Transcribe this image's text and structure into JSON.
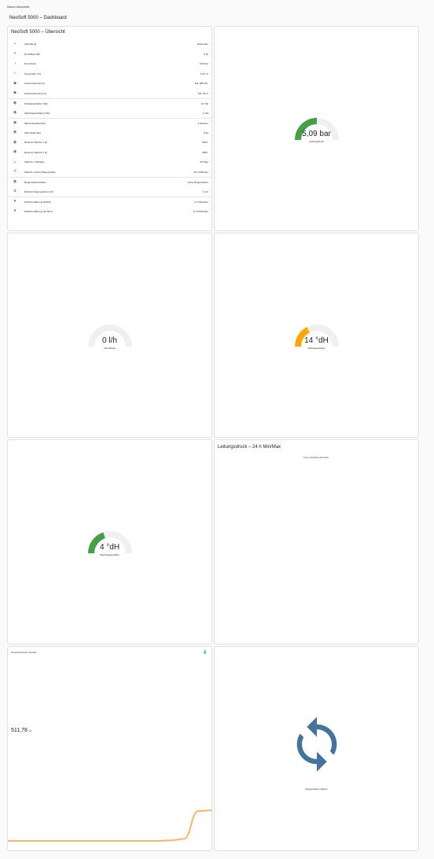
{
  "page": {
    "section_label": "Neuer Abschnitt",
    "dashboard_title": "NeoSoft 5000 – Dashboard"
  },
  "overview": {
    "title": "NeoSoft 5000 – Übersicht",
    "rows": [
      {
        "icon": "plug-icon",
        "label": "Verbindung",
        "value": "Verbunden",
        "divider": false
      },
      {
        "icon": "flow-icon",
        "label": "Durchfluss [l/h]",
        "value": "0 l/h",
        "divider": false
      },
      {
        "icon": "gauge-icon",
        "label": "Druck [bar]",
        "value": "5,09 bar",
        "divider": false
      },
      {
        "icon": "thermometer-icon",
        "label": "Temperatur [°C]",
        "value": "14,9 °C",
        "divider": false
      },
      {
        "icon": "water-icon",
        "label": "Gesamtvolumen [L]",
        "value": "511.785,00 L",
        "divider": false
      },
      {
        "icon": "water-icon",
        "label": "Gesamtvolumen [m³]",
        "value": "511,78 m³",
        "divider": false
      },
      {
        "icon": "eye-icon",
        "label": "Rohwasserhärte [°dH]",
        "value": "14 °dH",
        "divider": true
      },
      {
        "icon": "eye-icon",
        "label": "Weichwasserhärte [°dH]",
        "value": "4 °dH",
        "divider": false
      },
      {
        "icon": "eye-icon",
        "label": "Salzvorrat [Wochen]",
        "value": "4 Wochen",
        "divider": true
      },
      {
        "icon": "eye-icon",
        "label": "Salzmenge [kg]",
        "value": "8 kg",
        "divider": false
      },
      {
        "icon": "eye-icon",
        "label": "Reserve Flasche 1 [L]",
        "value": "869 L",
        "divider": false
      },
      {
        "icon": "eye-icon",
        "label": "Reserve Flasche 2 [L]",
        "value": "868 L",
        "divider": false
      },
      {
        "icon": "user-icon",
        "label": "Flasche 1 Salztage",
        "value": "49 Tage",
        "divider": false
      },
      {
        "icon": "history-icon",
        "label": "Flasche 1 letzte Regeneration",
        "value": "Vor 8 Minuten",
        "divider": false
      },
      {
        "icon": "eye-icon",
        "label": "Regenerationsstatus",
        "value": "keine Regeneration",
        "divider": true
      },
      {
        "icon": "hourglass-icon",
        "label": "Restzeit Regeneration [min]",
        "value": "0 min",
        "divider": false
      },
      {
        "icon": "circle-icon",
        "label": "Nächste Wartung [6 Mon]",
        "value": "In 4 Monaten",
        "divider": true
      },
      {
        "icon": "circle-icon",
        "label": "Nächste Wartung [12 Mon]",
        "value": "In 10 Monaten",
        "divider": false
      }
    ]
  },
  "gauges": {
    "pressure": {
      "display": "5,09 bar",
      "name": "Leitungsdruck",
      "level": 0.5,
      "color": "#43a047"
    },
    "flow": {
      "display": "0 l/h",
      "name": "Durchfluss",
      "level": 0,
      "color": "#43a047"
    },
    "raw_hardness": {
      "display": "14 °dH",
      "name": "Rohwasserhärte",
      "level": 0.35,
      "color": "#ffa600"
    },
    "soft_hardness": {
      "display": "4 °dH",
      "name": "Weichwasserhärte",
      "level": 0.4,
      "color": "#43a047"
    }
  },
  "statistics": {
    "title": "Leitungsdruck – 24 h Min/Max",
    "empty_text": "Keine Statistik gefunden."
  },
  "sensor_graph": {
    "title": "Gesamtvolumen Verlauf",
    "icon": "water-icon",
    "value": "511,78",
    "unit": "m³",
    "line_color": "#ffb366",
    "history": [
      0.12,
      0.12,
      0.12,
      0.12,
      0.12,
      0.12,
      0.12,
      0.12,
      0.12,
      0.12,
      0.12,
      0.13,
      0.17,
      0.88,
      0.9
    ]
  },
  "button": {
    "label": "Regeneration starten",
    "icon": "sync-icon",
    "color": "#44739e"
  }
}
